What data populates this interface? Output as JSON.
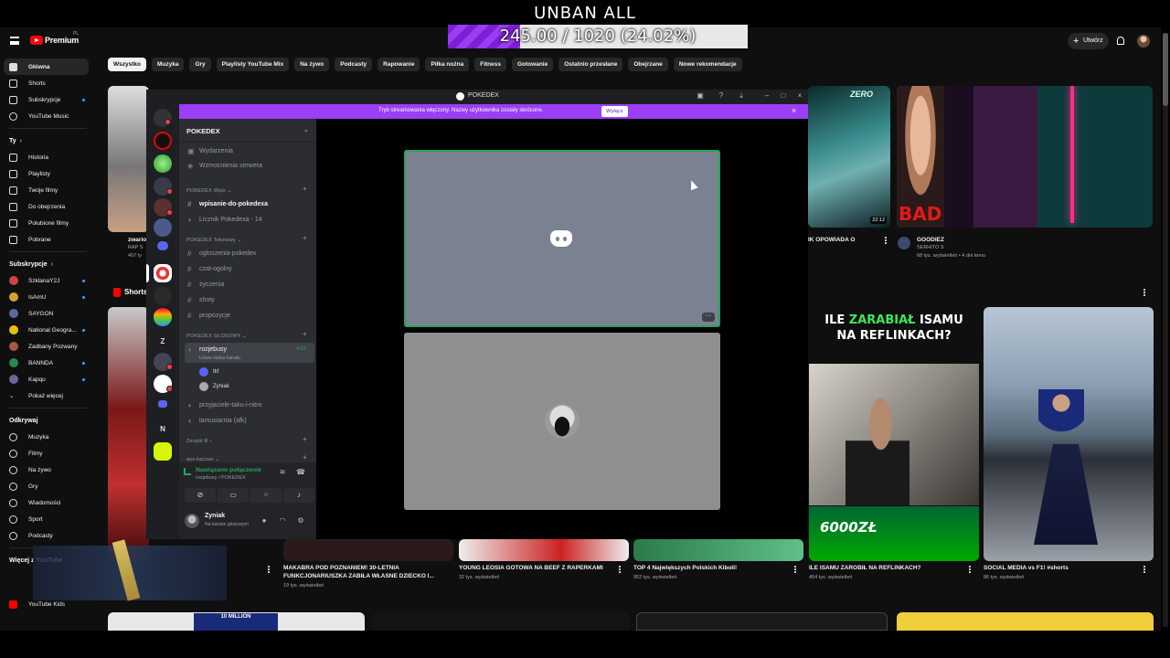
{
  "overlay": {
    "title": "UNBAN ALL",
    "progress_text": "245.00 / 1020 (24.02%)",
    "progress_fraction": 0.2402,
    "accent": "#8a2be2"
  },
  "youtube": {
    "brand": "Premium",
    "region": "PL",
    "create_label": "Utwórz",
    "chips": [
      "Wszystko",
      "Muzyka",
      "Gry",
      "Playlisty YouTube Mix",
      "Na żywo",
      "Podcasty",
      "Rapowanie",
      "Piłka nożna",
      "Fitness",
      "Gotowanie",
      "Ostatnio przesłane",
      "Obejrzane",
      "Nowe rekomendacje"
    ],
    "nav_main": [
      "Główna",
      "Shorts",
      "Subskrypcje",
      "YouTube Music"
    ],
    "you_header": "Ty",
    "nav_you": [
      "Historia",
      "Playlisty",
      "Twoje filmy",
      "Do obejrzenia",
      "Polubione filmy",
      "Pobrane"
    ],
    "subs_header": "Subskrypcje",
    "subs": [
      "SzklanaY2J",
      "IsAmU",
      "SAYGON",
      "National Geogra...",
      "Zadbany Pozwany",
      "BANNDA",
      "Kapqu"
    ],
    "show_more": "Pokaż więcej",
    "explore_header": "Odkrywaj",
    "explore": [
      "Muzyka",
      "Filmy",
      "Na żywo",
      "Gry",
      "Wiadomości",
      "Sport",
      "Podcasty"
    ],
    "more_header": "Więcej z YouTube",
    "more": [
      "YouTube Kids"
    ],
    "shorts_label": "Shorts",
    "videos_top": [
      {
        "title": "zwario",
        "meta1": "RAP S",
        "meta2": "407 ty"
      },
      {
        "title": "IK OPOWIADA O",
        "duration": "22:12"
      },
      {
        "title": "GOODIEZ",
        "channel": "SERHITO S",
        "meta": "68 tys. wyświetleń • 4 dni temu"
      }
    ],
    "videos_bottom": [
      {
        "title": "MAKABRA POD POZNANIEM! 30-LETNIA FUNKCJONARIUSZKA ZABIŁA WŁASNE DZIECKO I...",
        "meta": "19 tys. wyświetleń"
      },
      {
        "title": "YOUNG LEOSIA GOTOWA NA BEEF Z RAPERKAMI",
        "meta": "32 tys. wyświetleń"
      },
      {
        "title": "TOP 4 Największych Polskich Kiboli!",
        "meta": "952 tys. wyświetleń"
      },
      {
        "title": "ILE ISAMU ZAROBIŁ NA REFLINKACH?",
        "meta": "454 tys. wyświetleń"
      },
      {
        "title": "SOCIAL MEDIA vs F1! #shorts",
        "meta": "86 tys. wyświetleń"
      }
    ],
    "thumb_texts": {
      "isamu_line1": "ILE ",
      "isamu_green": "ZARABIAŁ",
      "isamu_line1b": " ISAMU",
      "isamu_line2": "NA REFLINKACH?",
      "isamu_money": "6000ZŁ",
      "bad": "BAD",
      "zero": "ZERO",
      "million": "10 MILLION"
    }
  },
  "discord": {
    "window_title": "POKEDEX",
    "banner_text": "Tryb streamowania włączony. Nazwy użytkownika zostały skrócone.",
    "banner_button": "Wyłącz",
    "server_name": "POKEDEX",
    "top_items": [
      "Wydarzenia",
      "Wzmocnienia serwera"
    ],
    "cat1": "POKEDEX Wpis",
    "cat1_channels": [
      "wpisanie-do-pokedexa",
      "Licznik Pokedexa - 14"
    ],
    "cat2": "POKEDEX Tekstowy",
    "cat2_channels": [
      "ogloszenia-pokedex",
      "czat-ogolny",
      "życzenia",
      "shoty",
      "propozycje"
    ],
    "cat3": "POKEDEX GŁOSOWY",
    "voice_channel": "rozjebusy",
    "voice_timer": "4:03",
    "voice_status": "Ustaw status kanału",
    "voice_users": [
      "tkf",
      "Zyniak"
    ],
    "cat3_more": [
      "przyjaciele-taku-i-nitro",
      "lamusiarnia (afk)"
    ],
    "cat4": "Zespół R",
    "cat5": "asz-kaczan",
    "connection_status": "Nawiązano połączenie",
    "connection_sub": "rozjebusy / POKEDEX",
    "user_name": "Zyniak",
    "user_status": "Na kanale głosowym",
    "guild_letters": [
      "Z",
      "N"
    ],
    "accent_green": "#23a55a",
    "banner_color": "#9b3ef5"
  }
}
